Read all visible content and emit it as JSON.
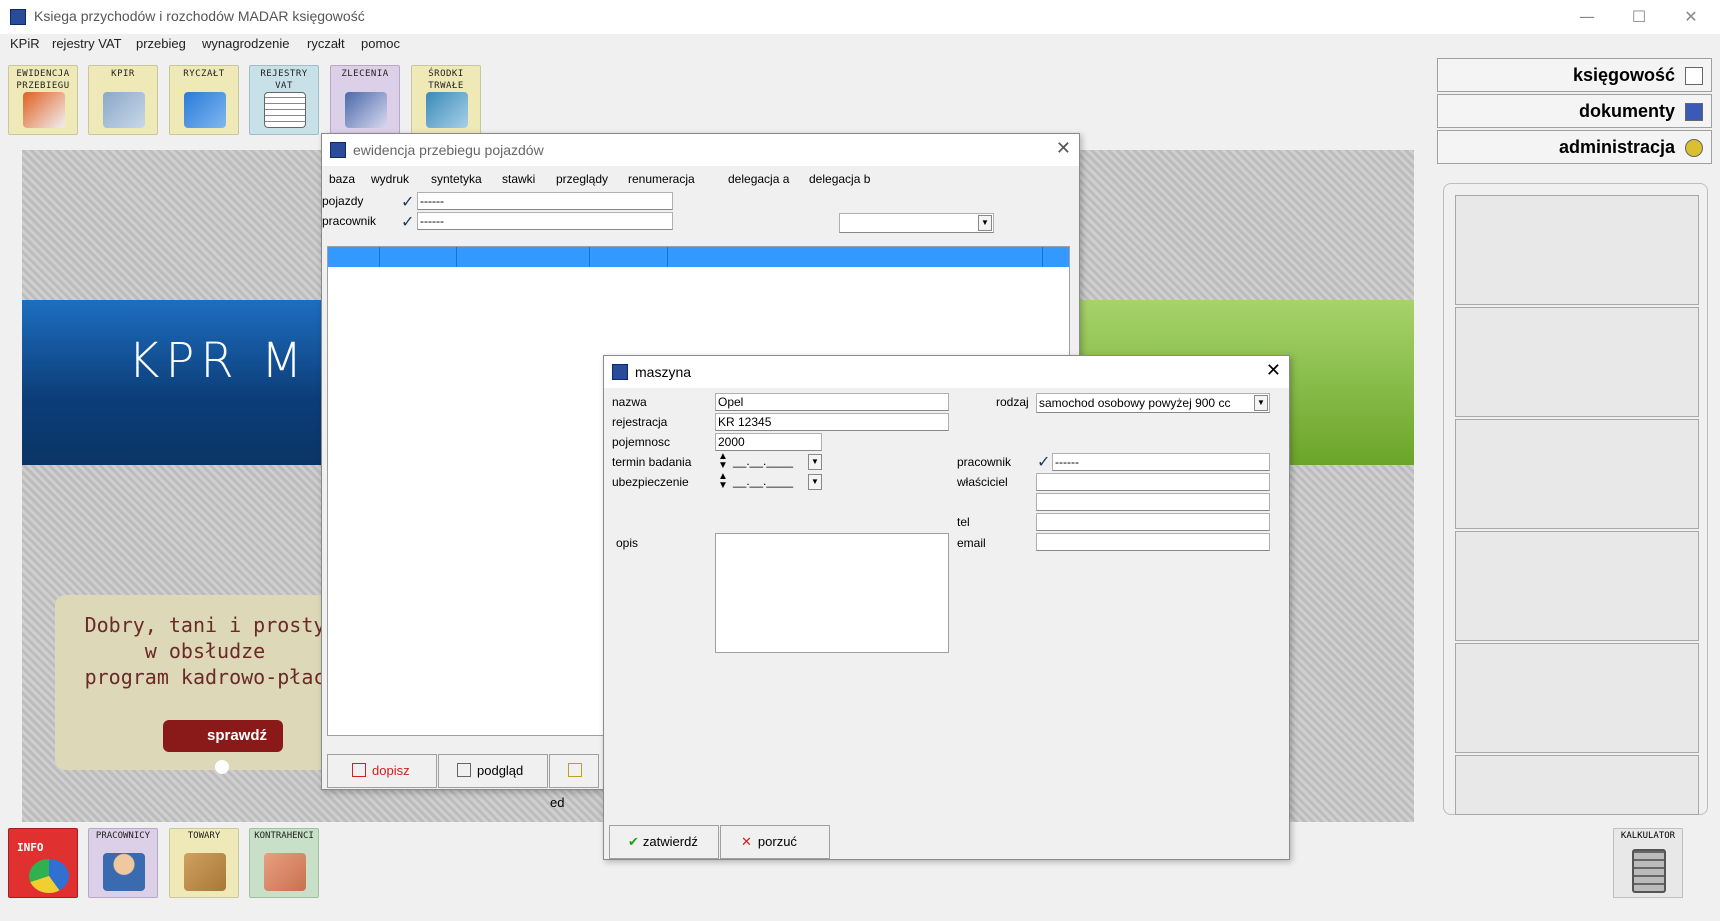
{
  "app": {
    "title": "Ksiega przychodów i rozchodów MADAR  księgowość",
    "minimize": "—",
    "maximize": "☐",
    "close": "✕"
  },
  "menu": [
    "KPiR",
    "rejestry VAT",
    "przebieg",
    "wynagrodzenie",
    "ryczałt",
    "pomoc"
  ],
  "toolbar": [
    {
      "label": "EWIDENCJA\nPRZEBIEGU",
      "icon": "car-document-icon"
    },
    {
      "label": "KPIR",
      "icon": "book-icon"
    },
    {
      "label": "RYCZAŁT",
      "icon": "blue-book-icon"
    },
    {
      "label": "REJESTRY\nVAT",
      "icon": "register-icon"
    },
    {
      "label": "ZLECENIA",
      "icon": "order-icon"
    },
    {
      "label": "ŚRODKI\nTRWAŁE",
      "icon": "fixed-assets-icon"
    }
  ],
  "banner": {
    "title": "KPR M",
    "promo_lines": [
      "Dobry, tani i prosty",
      "w obsłudze",
      "program kadrowo-płac"
    ],
    "promo_button": "sprawdź"
  },
  "right_panel": {
    "buttons": [
      "księgowość",
      "dokumenty",
      "administracja"
    ]
  },
  "bottom_toolbar": [
    {
      "label": "INFO",
      "icon": "info-chart-icon"
    },
    {
      "label": "PRACOWNICY",
      "icon": "employee-icon"
    },
    {
      "label": "TOWARY",
      "icon": "box-icon"
    },
    {
      "label": "KONTRAHENCI",
      "icon": "handshake-icon"
    }
  ],
  "calculator": {
    "label": "KALKULATOR"
  },
  "ewidencja": {
    "title": "ewidencja przebiegu pojazdów",
    "menu": [
      "baza",
      "wydruk",
      "syntetyka",
      "stawki",
      "przeglądy",
      "renumeracja",
      "delegacja a",
      "delegacja b"
    ],
    "pojazdy_label": "pojazdy",
    "pojazdy_value": "------",
    "pracownik_label": "pracownik",
    "pracownik_value": "------",
    "buttons": {
      "dopisz": "dopisz",
      "podglad": "podgląd",
      "edytuj": "ed"
    }
  },
  "maszyna": {
    "title": "maszyna",
    "nazwa_label": "nazwa",
    "nazwa_value": "Opel",
    "rejestracja_label": "rejestracja",
    "rejestracja_value": "KR 12345",
    "pojemnosc_label": "pojemnosc",
    "pojemnosc_value": "2000",
    "termin_label": "termin badania",
    "termin_value": "__.__.____",
    "ubezpieczenie_label": "ubezpieczenie",
    "ubezpieczenie_value": "__.__.____",
    "opis_label": "opis",
    "rodzaj_label": "rodzaj",
    "rodzaj_value": "samochod osobowy powyżej 900 cc",
    "pracownik_label": "pracownik",
    "pracownik_value": "------",
    "wlasciciel_label": "właściciel",
    "tel_label": "tel",
    "email_label": "email",
    "zatwierdz": "zatwierdź",
    "porzuc": "porzuć"
  },
  "colors": {
    "grid_header": "#3399ff",
    "promo_button": "#8a1a1a",
    "dopisz_text": "#d02020"
  }
}
